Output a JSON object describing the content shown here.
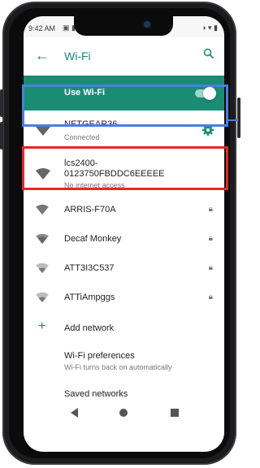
{
  "status_bar": {
    "time": "9:42 AM",
    "left_icons": "▣ ▮▮ ·",
    "right_icons": "◑ ▾ ▮"
  },
  "app_bar": {
    "back_icon": "arrow-back-icon",
    "title": "Wi-Fi",
    "search_icon": "search-icon"
  },
  "use_wifi": {
    "label": "Use Wi-Fi",
    "enabled": true
  },
  "connected_network": {
    "name": "NETGEAR36",
    "status": "Connected",
    "settings_icon": "gear-icon"
  },
  "selected_network": {
    "name_line1": "lcs2400-",
    "name_line2": "0123750FBDDC6EEEEE",
    "status": "No internet access"
  },
  "networks": [
    {
      "name": "ARRIS-F70A",
      "locked": true
    },
    {
      "name": "Decaf Monkey",
      "locked": true
    },
    {
      "name": "ATT3I3C537",
      "locked": true
    },
    {
      "name": "ATTiAmpggs",
      "locked": true
    }
  ],
  "add_network": {
    "label": "Add network"
  },
  "preferences": {
    "title": "Wi-Fi preferences",
    "subtitle": "Wi-Fi turns back on automatically"
  },
  "saved_networks": {
    "label": "Saved networks"
  },
  "nav": {
    "back": "nav-back-icon",
    "home": "nav-home-icon",
    "recents": "nav-recents-icon"
  },
  "colors": {
    "accent": "#1a8c74",
    "highlight_blue": "#4a7fe0",
    "highlight_red": "#e52822"
  }
}
